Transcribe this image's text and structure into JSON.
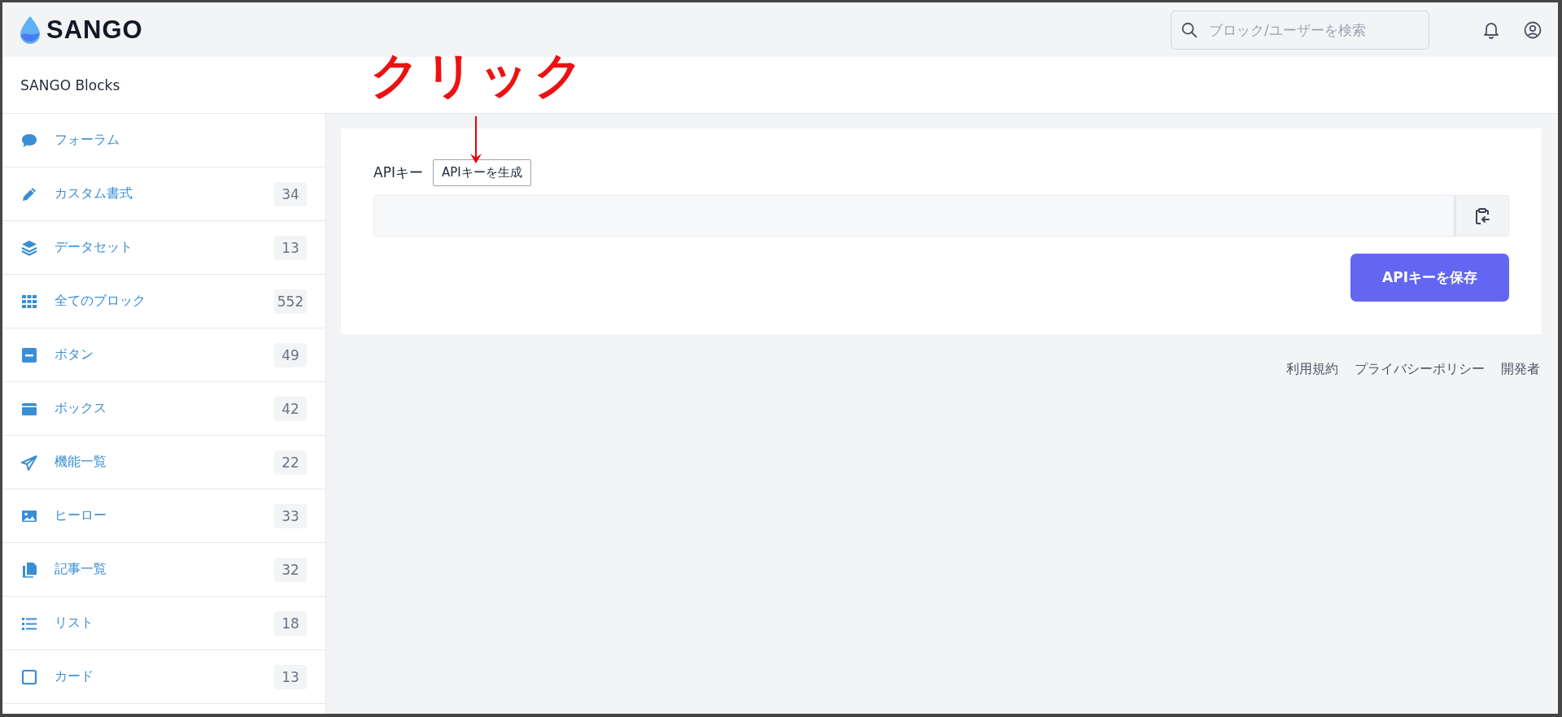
{
  "header": {
    "logo": "SANGO",
    "search": {
      "placeholder": "ブロック/ユーザーを検索"
    }
  },
  "site_title": "SANGO Blocks",
  "annotation": {
    "text": "クリック"
  },
  "sidebar": {
    "items": [
      {
        "label": "フォーラム"
      },
      {
        "label": "カスタム書式",
        "count": "34"
      },
      {
        "label": "データセット",
        "count": "13"
      },
      {
        "label": "全てのブロック",
        "count": "552"
      },
      {
        "label": "ボタン",
        "count": "49"
      },
      {
        "label": "ボックス",
        "count": "42"
      },
      {
        "label": "機能一覧",
        "count": "22"
      },
      {
        "label": "ヒーロー",
        "count": "33"
      },
      {
        "label": "記事一覧",
        "count": "32"
      },
      {
        "label": "リスト",
        "count": "18"
      },
      {
        "label": "カード",
        "count": "13"
      }
    ]
  },
  "api_form": {
    "label": "APIキー",
    "generate_button": "APIキーを生成",
    "save_button": "APIキーを保存"
  },
  "footer": {
    "links": [
      "利用規約",
      "プライバシーポリシー",
      "開発者"
    ]
  }
}
